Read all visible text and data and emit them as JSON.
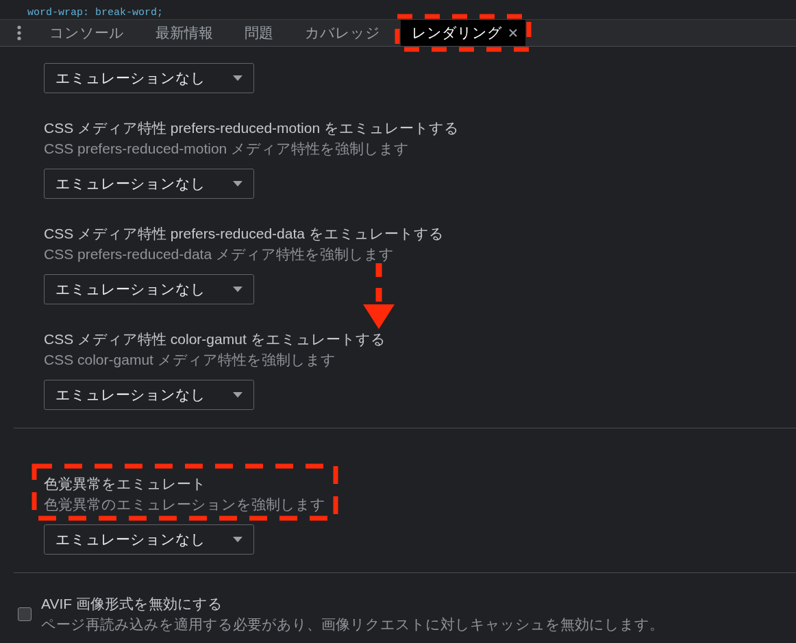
{
  "code_line": "word-wrap: break-word;",
  "tabs": [
    {
      "label": "コンソール",
      "selected": false
    },
    {
      "label": "最新情報",
      "selected": false
    },
    {
      "label": "問題",
      "selected": false
    },
    {
      "label": "カバレッジ",
      "selected": false
    },
    {
      "label": "レンダリング",
      "selected": true,
      "closable": true
    }
  ],
  "groups": [
    {
      "items": [
        {
          "kind": "select",
          "value": "エミュレーションなし"
        },
        {
          "kind": "select",
          "title": "CSS メディア特性 prefers-reduced-motion をエミュレートする",
          "description": "CSS prefers-reduced-motion メディア特性を強制します",
          "value": "エミュレーションなし"
        },
        {
          "kind": "select",
          "title": "CSS メディア特性 prefers-reduced-data をエミュレートする",
          "description": "CSS prefers-reduced-data メディア特性を強制します",
          "value": "エミュレーションなし"
        },
        {
          "kind": "select",
          "title": "CSS メディア特性 color-gamut をエミュレートする",
          "description": "CSS color-gamut メディア特性を強制します",
          "value": "エミュレーションなし"
        }
      ]
    },
    {
      "items": [
        {
          "kind": "select",
          "title": "色覚異常をエミュレート",
          "description": "色覚異常のエミュレーションを強制します",
          "value": "エミュレーションなし"
        }
      ]
    },
    {
      "items": [
        {
          "kind": "checkbox",
          "title": "AVIF 画像形式を無効にする",
          "description": "ページ再読み込みを適用する必要があり、画像リクエストに対しキャッシュを無効にします。",
          "checked": false
        }
      ]
    }
  ]
}
